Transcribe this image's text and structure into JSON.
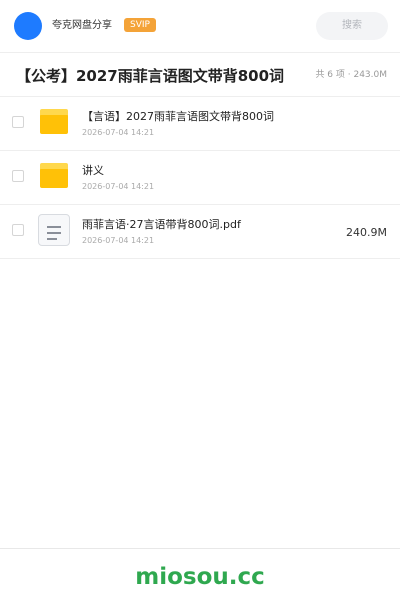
{
  "header": {
    "brand": "夸克网盘分享",
    "badge": "SVIP",
    "search_label": "搜索"
  },
  "share": {
    "title": "【公考】2027雨菲言语图文带背800词",
    "summary": "共 6 项 · 243.0M"
  },
  "files": [
    {
      "name": "【言语】2027雨菲言语图文带背800词",
      "date": "2026-07-04 14:21",
      "size": "",
      "type": "folder"
    },
    {
      "name": "讲义",
      "date": "2026-07-04 14:21",
      "size": "",
      "type": "folder"
    },
    {
      "name": "雨菲言语·27言语带背800词.pdf",
      "date": "2026-07-04 14:21",
      "size": "240.9M",
      "type": "pdf"
    }
  ],
  "footer": {
    "watermark": "miosou.cc"
  },
  "colors": {
    "avatar": "#1e7bff",
    "badge": "#f4a338",
    "folder": "#ffc107",
    "watermark": "#2fa84f"
  },
  "icons": {
    "avatar": "user-avatar",
    "folder": "folder-icon",
    "file": "pdf-file-icon"
  }
}
